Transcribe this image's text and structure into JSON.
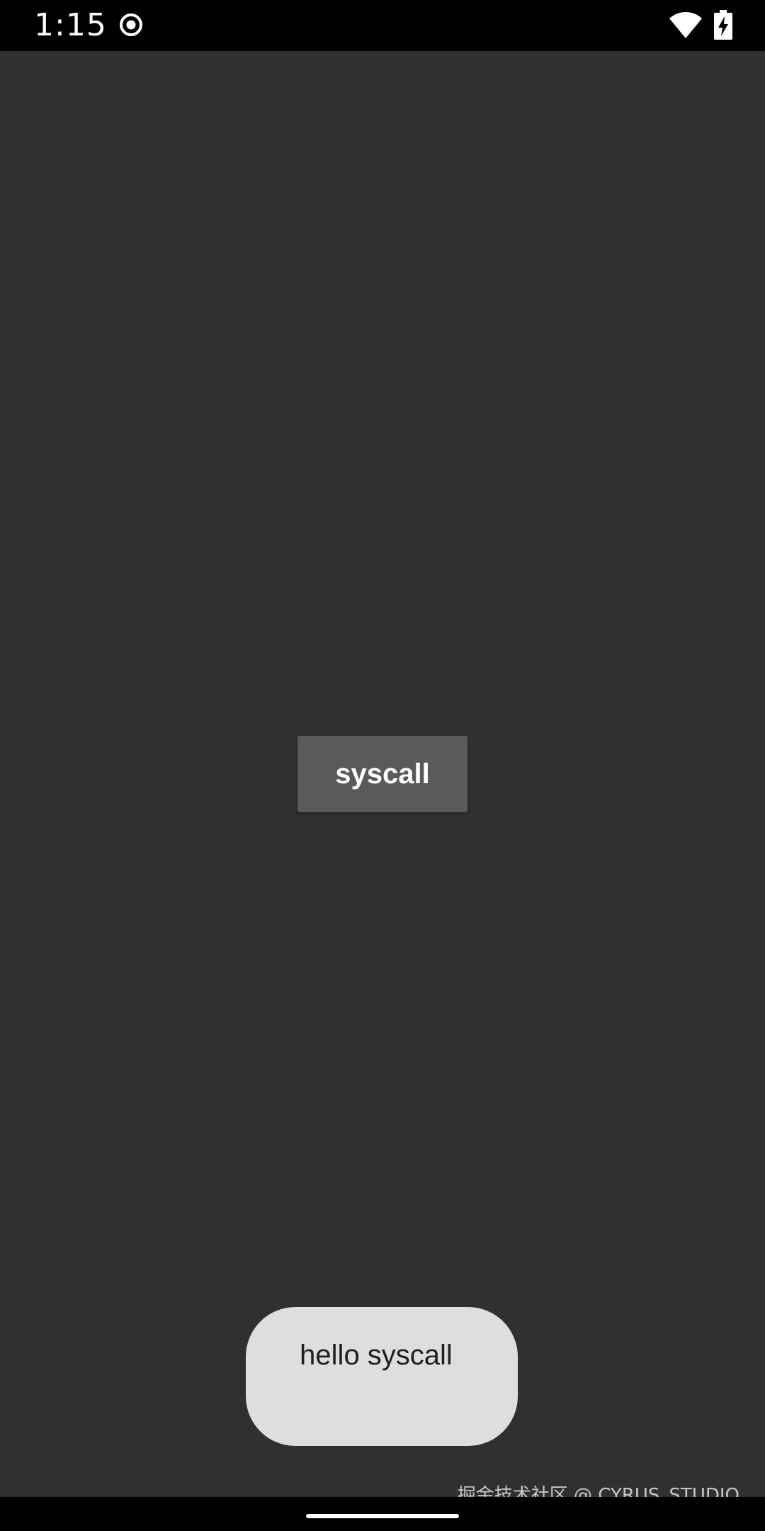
{
  "status_bar": {
    "time": "1:15",
    "icons": [
      "record-icon",
      "wifi-icon",
      "battery-charging-icon"
    ]
  },
  "main": {
    "button_label": "syscall"
  },
  "toast": {
    "message": "hello syscall"
  },
  "watermark": {
    "text": "掘金技术社区 @ CYRUS_STUDIO"
  },
  "colors": {
    "background": "#303030",
    "status_bar": "#000000",
    "button": "#5a5a5a",
    "button_text": "#ffffff",
    "toast_background": "#dedede",
    "toast_text": "#1f1f1f"
  }
}
